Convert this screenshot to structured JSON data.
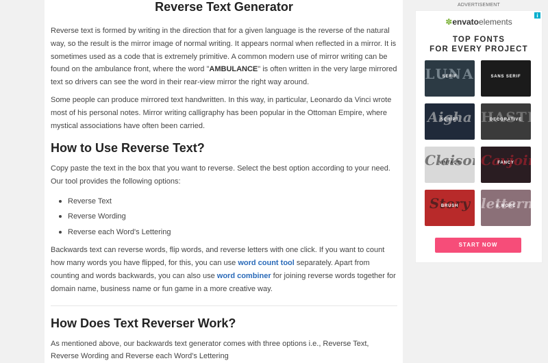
{
  "article": {
    "title": "Reverse Text Generator",
    "intro_p1_before": "Reverse text is formed by writing in the direction that for a given language is the reverse of the natural way, so the result is the mirror image of normal writing. It appears normal when reflected in a mirror. It is sometimes used as a code that is extremely primitive. A common modern use of mirror writing can be found on the ambulance front, where the word \"",
    "intro_p1_strong": "AMBULANCE",
    "intro_p1_after": "\" is often written in the very large mirrored text so drivers can see the word in their rear-view mirror the right way around.",
    "intro_p2": "Some people can produce mirrored text handwritten. In this way, in particular, Leonardo da Vinci wrote most of his personal notes. Mirror writing calligraphy has been popular in the Ottoman Empire, where mystical associations have often been carried.",
    "how_to_heading": "How to Use Reverse Text?",
    "how_to_p": "Copy paste the text in the box that you want to reverse. Select the best option according to your need. Our tool provides the following options:",
    "options": [
      "Reverse Text",
      "Reverse Wording",
      "Reverse each Word's Lettering"
    ],
    "backwards_p_1": "Backwards text can reverse words, flip words, and reverse letters with one click. If you want to count how many words you have flipped, for this, you can use ",
    "word_count_link": "word count tool",
    "backwards_p_2": " separately. Apart from counting and words backwards, you can also use ",
    "word_combiner_link": "word combiner",
    "backwards_p_3": " for joining reverse words together for domain name, business name or fun game in a more creative way.",
    "how_works_heading": "How Does Text Reverser Work?",
    "how_works_p": "As mentioned above, our backwards text generator comes with three options i.e., Reverse Text, Reverse Wording and Reverse each Word's Lettering"
  },
  "ad": {
    "label": "ADVERTISEMENT",
    "brand_strong": "envato",
    "brand_rest": "elements",
    "headline_1": "TOP FONTS",
    "headline_2": "FOR EVERY PROJECT",
    "tiles": [
      {
        "label": "SERIF",
        "art": "LUNA",
        "bg": "#2c3a44"
      },
      {
        "label": "SANS SERIF",
        "art": "",
        "bg": "#1b1b1b"
      },
      {
        "label": "SCRIPT",
        "art": "Aigha",
        "bg": "#202a3a"
      },
      {
        "label": "DECORATIVE",
        "art": "HASTE",
        "bg": "#3b3b3b"
      },
      {
        "label": "VINTAGE",
        "art": "Claison",
        "bg": "#d9d9d9"
      },
      {
        "label": "FANCY",
        "art": "Cavjoint",
        "bg": "#2a1d22"
      },
      {
        "label": "BRUSH",
        "art": "Story",
        "bg": "#b82a2a"
      },
      {
        "label": "& MORE",
        "art": "lettern",
        "bg": "#8b7078"
      }
    ],
    "cta": "START NOW",
    "accent": "#f64d79",
    "leaf_color": "#82b541"
  }
}
